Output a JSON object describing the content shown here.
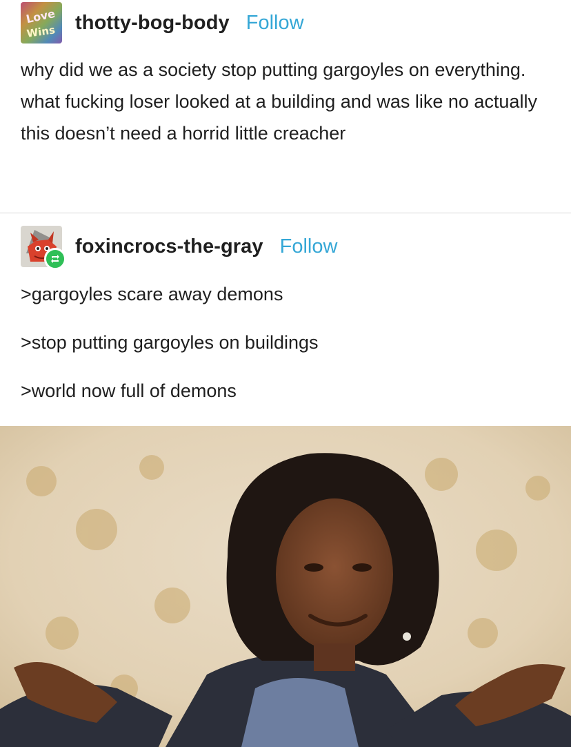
{
  "post1": {
    "username": "thotty-bog-body",
    "follow_label": "Follow",
    "text": "why did we as a society stop putting gargoyles on everything. what fucking loser looked at a building and was like no actually this doesn’t need a horrid little creacher"
  },
  "post2": {
    "username": "foxincrocs-the-gray",
    "follow_label": "Follow",
    "lines": [
      ">gargoyles scare away demons",
      ">stop putting gargoyles on buildings",
      ">world now full of demons"
    ]
  },
  "icons": {
    "avatar1": "love-wins-avatar-icon",
    "avatar2": "red-fox-wizard-avatar-icon",
    "reblog": "reblog-icon"
  },
  "colors": {
    "follow": "#35a7d6",
    "reblog_badge": "#2fbf57",
    "divider": "#d6d6d6"
  }
}
